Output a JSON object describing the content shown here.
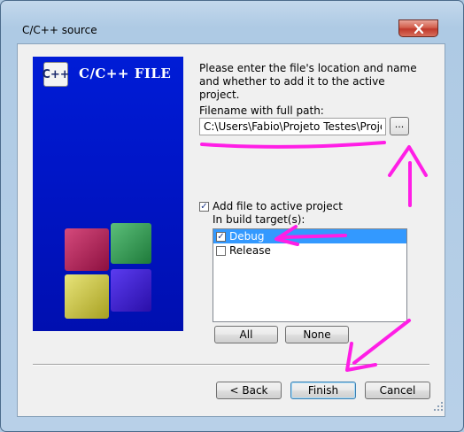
{
  "window": {
    "title": "C/C++ source",
    "close_icon": "close-icon"
  },
  "banner": {
    "logo_text": "C++",
    "title": "C/C++ FILE"
  },
  "form": {
    "instructions": "Please enter the file's location and name and whether to add it to the active project.",
    "filename_label": "Filename with full path:",
    "filename_value": "C:\\Users\\Fabio\\Projeto Testes\\Projeto_t",
    "browse_label": "...",
    "add_to_project_label": "Add file to active project",
    "add_to_project_checked": true,
    "build_targets_label": "In build target(s):",
    "targets": [
      {
        "label": "Debug",
        "checked": true,
        "selected": true
      },
      {
        "label": "Release",
        "checked": false,
        "selected": false
      }
    ],
    "all_button": "All",
    "none_button": "None"
  },
  "footer": {
    "back_button": "< Back",
    "finish_button": "Finish",
    "cancel_button": "Cancel"
  },
  "annotation_color": "#ff1ee6"
}
